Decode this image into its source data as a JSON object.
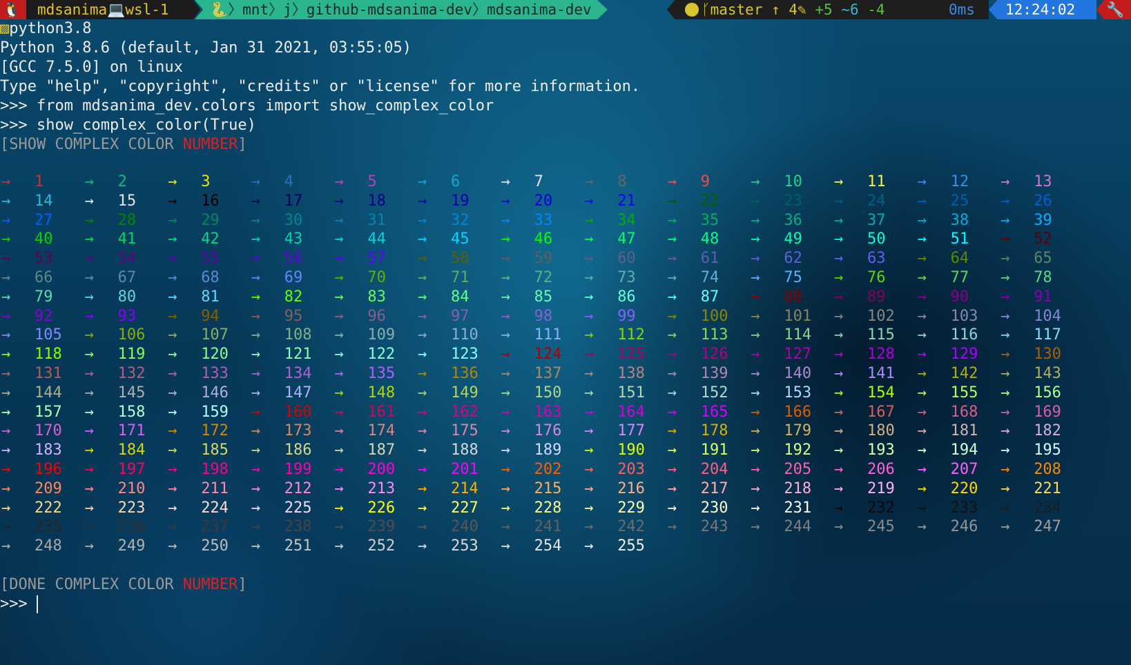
{
  "prompt": {
    "os_icon": "🐧",
    "user": "mdsanima",
    "device_icon": "laptop-icon",
    "host": "wsl-1",
    "path_icon": "🐍",
    "path_segments": [
      "mnt",
      "j",
      "github-mdsanima-dev",
      "mdsanima-dev"
    ],
    "git_branch": "master",
    "git_ahead": "↑ 4",
    "git_status": {
      "added": "+5",
      "modified": "~6",
      "deleted": "-4"
    },
    "duration": "0ms",
    "time": "12:24:02",
    "end_icon": "🔧"
  },
  "terminal": {
    "command_line": "python3.8",
    "banner": [
      "Python 3.8.6 (default, Jan 31 2021, 03:55:05)",
      "[GCC 7.5.0] on linux",
      "Type \"help\", \"copyright\", \"credits\" or \"license\" for more information."
    ],
    "inputs": [
      ">>> from mdsanima_dev.colors import show_complex_color",
      ">>> show_complex_color(True)"
    ],
    "show_header": {
      "prefix": "[SHOW COMPLEX COLOR ",
      "highlight": "NUMBER",
      "suffix": "]"
    },
    "done_header": {
      "prefix": "[DONE COMPLEX COLOR ",
      "highlight": "NUMBER",
      "suffix": "]"
    },
    "prompt_symbol": ">>>",
    "arrow": "→",
    "color_count": 255,
    "columns": 13
  }
}
